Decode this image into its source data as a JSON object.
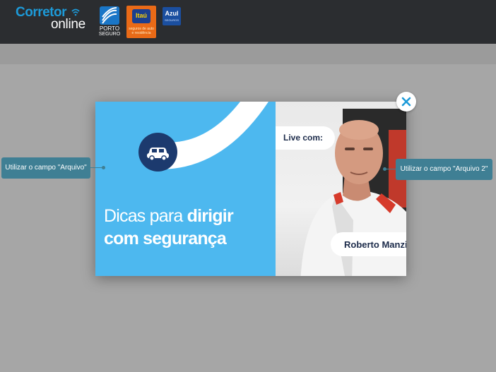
{
  "header": {
    "brand_line1": "Corretor",
    "brand_line2": "online",
    "partners": [
      {
        "name": "porto-seguro",
        "text1": "PORTO",
        "text2": "SEGURO"
      },
      {
        "name": "itau",
        "text": "Itaú",
        "sub": "seguros de auto e residência"
      },
      {
        "name": "azul",
        "text": "Azul",
        "sub": "SEGUROS"
      }
    ]
  },
  "modal": {
    "headline_light": "Dicas para ",
    "headline_bold1": "dirigir",
    "headline_bold2": "com segurança",
    "live_label": "Live com:",
    "speaker_name": "Roberto Manzini",
    "car_icon": "car-icon",
    "close_icon": "close-icon",
    "colors": {
      "accent": "#4db8ef",
      "dark_blue": "#1c3a6e",
      "close_x": "#1d9ad8"
    }
  },
  "annotations": {
    "left": "Utilizar o campo \"Arquivo\"",
    "right": "Utilizar o campo \"Arquivo 2\""
  }
}
